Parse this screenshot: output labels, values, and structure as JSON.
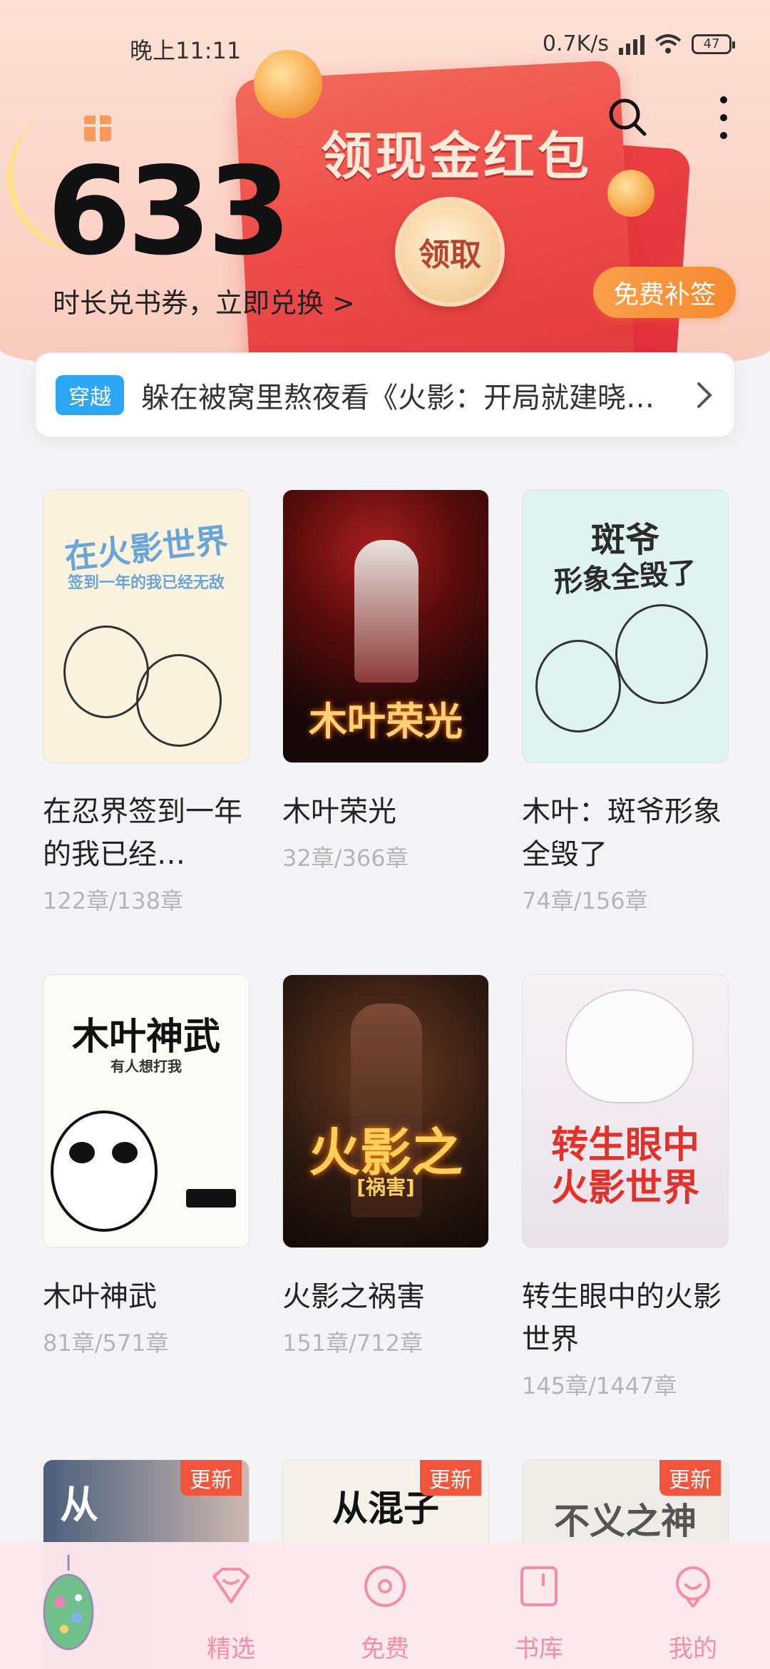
{
  "status_bar": {
    "time": "晚上11:11",
    "net_speed": "0.7K/s",
    "battery": "47"
  },
  "header": {
    "points": "633",
    "redeem_text": "时长兑书券，立即兑换 >",
    "packet_title": "领现金红包",
    "claim_label": "领取",
    "signin_label": "免费补签"
  },
  "notice": {
    "tag": "穿越",
    "text": "躲在被窝里熬夜看《火影：开局就建晓…"
  },
  "books": [
    {
      "title": "在忍界签到一年的我已经…",
      "chapters": "122章/138章",
      "cover_text": "在火影世界",
      "cover_sub": "签到一年的我已经无敌",
      "cover_bg": "#fbf3de",
      "cover_color": "#6aa5d8"
    },
    {
      "title": "木叶荣光",
      "chapters": "32章/366章",
      "cover_text": "木叶荣光",
      "cover_sub": "",
      "cover_bg": "#1b0e10",
      "cover_color": "#ffd27a"
    },
    {
      "title": "木叶：斑爷形象全毁了",
      "chapters": "74章/156章",
      "cover_text": "斑爷",
      "cover_sub": "形象全毁了",
      "cover_bg": "#dff3ef",
      "cover_color": "#2b2b2b"
    },
    {
      "title": "木叶神武",
      "chapters": "81章/571章",
      "cover_text": "木叶神武",
      "cover_sub": "有人想打我",
      "cover_bg": "#fbfbf8",
      "cover_color": "#111111"
    },
    {
      "title": "火影之祸害",
      "chapters": "151章/712章",
      "cover_text": "火影之",
      "cover_sub": "[祸害]",
      "cover_bg": "#2a1810",
      "cover_color": "#ffcf5a"
    },
    {
      "title": "转生眼中的火影世界",
      "chapters": "145章/1447章",
      "cover_text": "转生眼中",
      "cover_sub": "火影世界",
      "cover_bg": "#f3eef2",
      "cover_color": "#e0312b"
    }
  ],
  "partial_books": [
    {
      "badge": "更新",
      "cover_text": "从",
      "cover_bg": "#5a6f8c",
      "cover_color": "#ffffff"
    },
    {
      "badge": "更新",
      "cover_text": "从混子",
      "cover_bg": "#f6f2ea",
      "cover_color": "#111111"
    },
    {
      "badge": "更新",
      "cover_text": "不义之神",
      "cover_bg": "#efece8",
      "cover_color": "#555555"
    }
  ],
  "nav": [
    {
      "label": "精选",
      "icon": "diamond-heart-icon"
    },
    {
      "label": "免费",
      "icon": "coin-icon"
    },
    {
      "label": "书库",
      "icon": "bookshelf-icon"
    },
    {
      "label": "我的",
      "icon": "profile-face-icon"
    }
  ],
  "colors": {
    "accent": "#f28fa6",
    "tag_blue": "#2ba7f5",
    "signin_orange": "#f7892f",
    "packet_red": "#e23a3e",
    "update_badge": "#f2553e"
  }
}
